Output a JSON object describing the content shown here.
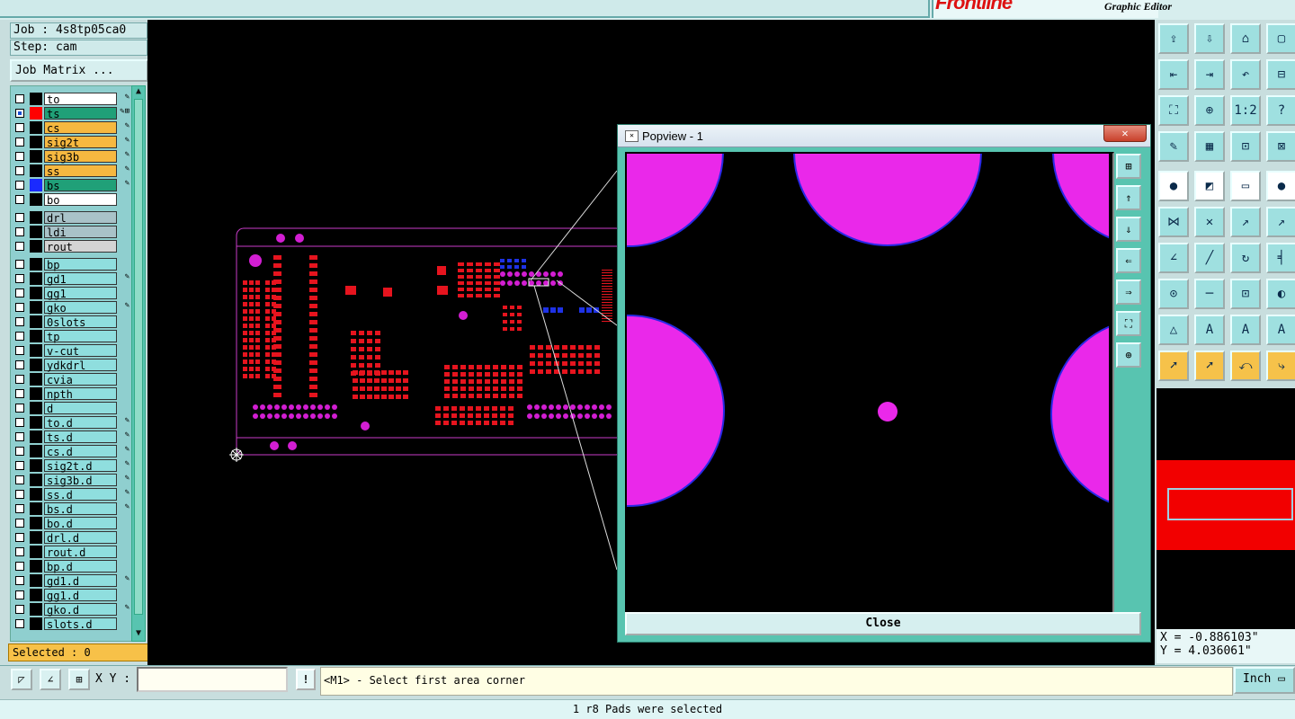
{
  "brand": {
    "logo": "Frontline",
    "subtitle": "Graphic Editor"
  },
  "job": {
    "job_line": "Job : 4s8tp05ca0",
    "step_line": "Step: cam",
    "matrix_label": "Job Matrix ..."
  },
  "layers": [
    {
      "name": "to",
      "color": "#ffffff",
      "bg": "#ffffff",
      "checked": false,
      "mark": "✎"
    },
    {
      "name": "ts",
      "color": "#ff0000",
      "bg": "#20a078",
      "checked": true,
      "mark": "✎⊞"
    },
    {
      "name": "cs",
      "color": "#000000",
      "bg": "#f6b840",
      "checked": false,
      "mark": "✎"
    },
    {
      "name": "sig2t",
      "color": "#000000",
      "bg": "#f6b840",
      "checked": false,
      "mark": "✎"
    },
    {
      "name": "sig3b",
      "color": "#000000",
      "bg": "#f6b840",
      "checked": false,
      "mark": "✎"
    },
    {
      "name": "ss",
      "color": "#000000",
      "bg": "#f6b840",
      "checked": false,
      "mark": "✎"
    },
    {
      "name": "bs",
      "color": "#1a2aff",
      "bg": "#20a078",
      "checked": false,
      "mark": "✎"
    },
    {
      "name": "bo",
      "color": "#000000",
      "bg": "#ffffff",
      "checked": false,
      "mark": ""
    },
    {
      "name": "drl",
      "color": "#000000",
      "bg": "#a9c2c8",
      "checked": false,
      "mark": ""
    },
    {
      "name": "ldi",
      "color": "#000000",
      "bg": "#a9c2c8",
      "checked": false,
      "mark": ""
    },
    {
      "name": "rout",
      "color": "#000000",
      "bg": "#d4d4d4",
      "checked": false,
      "mark": ""
    },
    {
      "name": "bp",
      "color": "#000000",
      "bg": "#8fdede",
      "checked": false,
      "mark": ""
    },
    {
      "name": "gd1",
      "color": "#000000",
      "bg": "#8fdede",
      "checked": false,
      "mark": "✎"
    },
    {
      "name": "gg1",
      "color": "#000000",
      "bg": "#8fdede",
      "checked": false,
      "mark": ""
    },
    {
      "name": "gko",
      "color": "#000000",
      "bg": "#8fdede",
      "checked": false,
      "mark": "✎"
    },
    {
      "name": "0slots",
      "color": "#000000",
      "bg": "#8fdede",
      "checked": false,
      "mark": ""
    },
    {
      "name": "tp",
      "color": "#000000",
      "bg": "#8fdede",
      "checked": false,
      "mark": ""
    },
    {
      "name": "v-cut",
      "color": "#000000",
      "bg": "#8fdede",
      "checked": false,
      "mark": ""
    },
    {
      "name": "ydkdrl",
      "color": "#000000",
      "bg": "#8fdede",
      "checked": false,
      "mark": ""
    },
    {
      "name": "cvia",
      "color": "#000000",
      "bg": "#8fdede",
      "checked": false,
      "mark": ""
    },
    {
      "name": "npth",
      "color": "#000000",
      "bg": "#8fdede",
      "checked": false,
      "mark": ""
    },
    {
      "name": "d",
      "color": "#000000",
      "bg": "#8fdede",
      "checked": false,
      "mark": ""
    },
    {
      "name": "to.d",
      "color": "#000000",
      "bg": "#8fdede",
      "checked": false,
      "mark": "✎"
    },
    {
      "name": "ts.d",
      "color": "#000000",
      "bg": "#8fdede",
      "checked": false,
      "mark": "✎"
    },
    {
      "name": "cs.d",
      "color": "#000000",
      "bg": "#8fdede",
      "checked": false,
      "mark": "✎"
    },
    {
      "name": "sig2t.d",
      "color": "#000000",
      "bg": "#8fdede",
      "checked": false,
      "mark": "✎"
    },
    {
      "name": "sig3b.d",
      "color": "#000000",
      "bg": "#8fdede",
      "checked": false,
      "mark": "✎"
    },
    {
      "name": "ss.d",
      "color": "#000000",
      "bg": "#8fdede",
      "checked": false,
      "mark": "✎"
    },
    {
      "name": "bs.d",
      "color": "#000000",
      "bg": "#8fdede",
      "checked": false,
      "mark": "✎"
    },
    {
      "name": "bo.d",
      "color": "#000000",
      "bg": "#8fdede",
      "checked": false,
      "mark": ""
    },
    {
      "name": "drl.d",
      "color": "#000000",
      "bg": "#8fdede",
      "checked": false,
      "mark": ""
    },
    {
      "name": "rout.d",
      "color": "#000000",
      "bg": "#8fdede",
      "checked": false,
      "mark": ""
    },
    {
      "name": "bp.d",
      "color": "#000000",
      "bg": "#8fdede",
      "checked": false,
      "mark": ""
    },
    {
      "name": "gd1.d",
      "color": "#000000",
      "bg": "#8fdede",
      "checked": false,
      "mark": "✎"
    },
    {
      "name": "gg1.d",
      "color": "#000000",
      "bg": "#8fdede",
      "checked": false,
      "mark": ""
    },
    {
      "name": "gko.d",
      "color": "#000000",
      "bg": "#8fdede",
      "checked": false,
      "mark": "✎"
    },
    {
      "name": "slots.d",
      "color": "#000000",
      "bg": "#8fdede",
      "checked": false,
      "mark": ""
    }
  ],
  "selected_label": "Selected : 0",
  "popview": {
    "title": "Popview - 1",
    "close_x": "✕",
    "close_button": "Close"
  },
  "coords": {
    "x": "X = -0.886103\"",
    "y": "Y = 4.036061\""
  },
  "command": {
    "xy_label": "X Y :",
    "xy_value": "",
    "excl": "!",
    "prompt": "<M1> - Select first area corner",
    "unit": "Inch ▭"
  },
  "status": "1 r8 Pads were selected",
  "toolbar_icons": [
    "open-icon",
    "save-icon",
    "home-icon",
    "window-icon",
    "export-icon",
    "import-icon",
    "undo-icon",
    "layer-icon",
    "zoom-fit-icon",
    "zoom-home-icon",
    "scale-icon",
    "help-icon",
    "tool-icon",
    "grid-icon",
    "snap-icon",
    "net-icon",
    "pad-icon",
    "line-icon",
    "measure-icon",
    "dot-icon",
    "node-icon",
    "cross-icon",
    "point-icon",
    "arrow-icon",
    "draw-icon",
    "edit-icon",
    "rotate-icon",
    "split-icon",
    "move-icon",
    "cut-icon",
    "copy-icon",
    "shape-icon",
    "angle-icon",
    "trace-icon",
    "arc-icon",
    "route-icon",
    "select-icon",
    "pick-icon",
    "lasso-icon",
    "path-icon"
  ],
  "popup_tools": [
    "popup-zoom-icon",
    "popup-up-icon",
    "popup-down-icon",
    "popup-left-icon",
    "popup-right-icon",
    "popup-fit-icon",
    "popup-center-icon"
  ]
}
